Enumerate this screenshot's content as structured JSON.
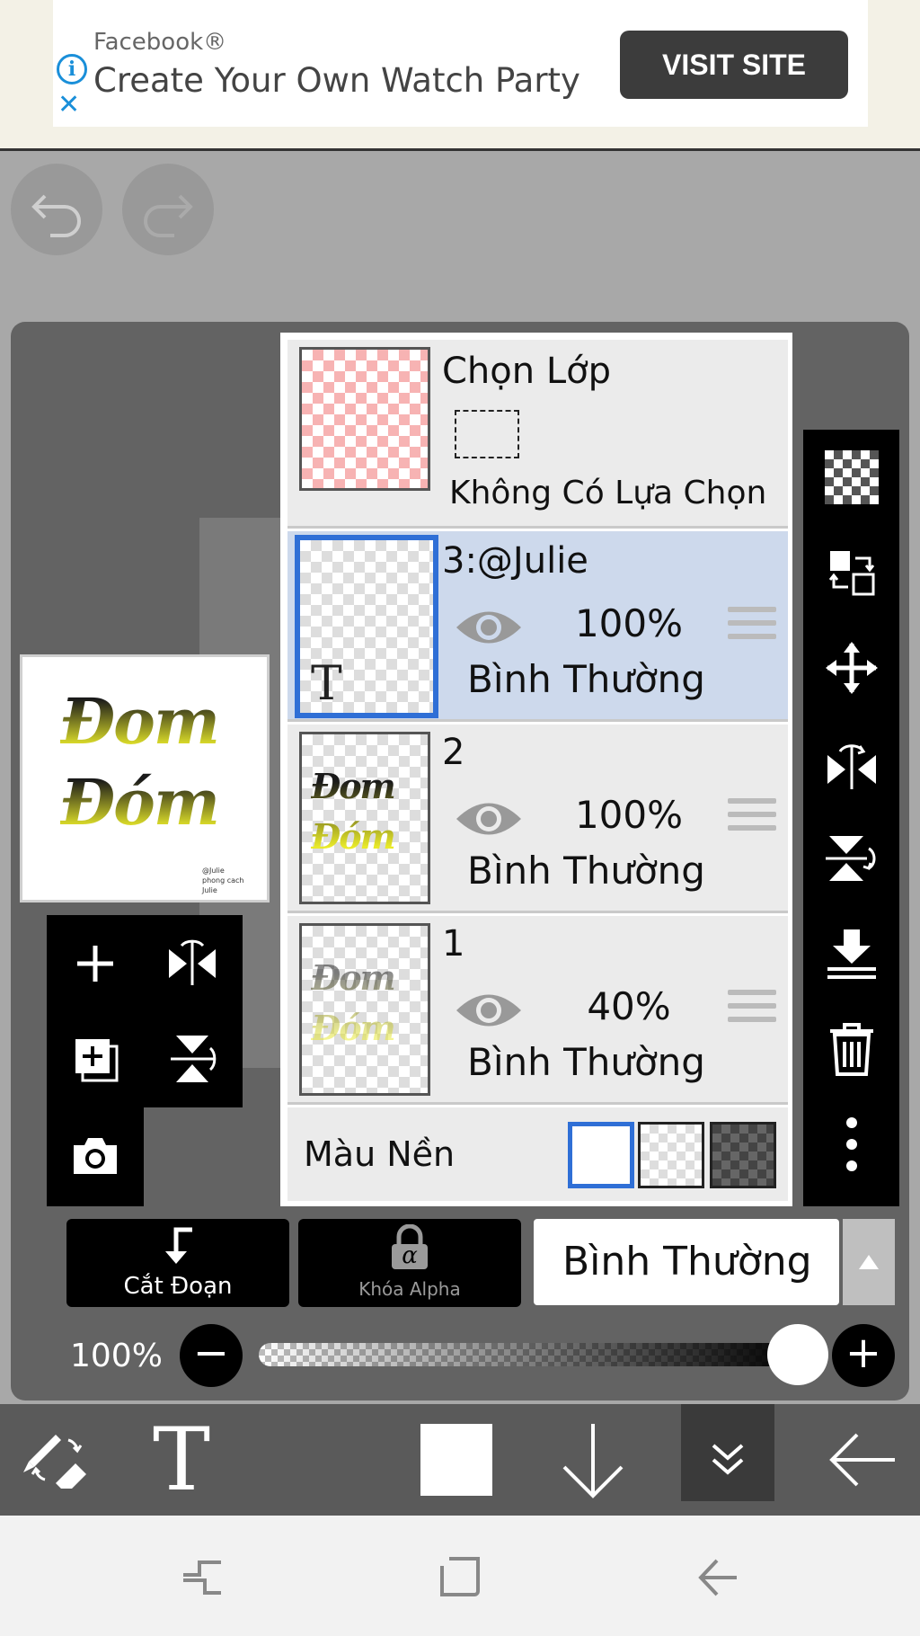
{
  "ad": {
    "brand": "Facebook®",
    "title": "Create Your Own Watch Party",
    "cta": "VISIT SITE"
  },
  "canvas_preview": {
    "line1": "Đom",
    "line2": "Đóm",
    "small_text": [
      "@Julie",
      "phong cach",
      "Julie"
    ]
  },
  "layers_panel": {
    "selection": {
      "title": "Chọn Lớp",
      "status": "Không Có Lựa Chọn"
    },
    "layers": [
      {
        "name": "3:@Julie",
        "opacity": "100%",
        "blend": "Bình Thường",
        "selected": true,
        "thumb_glyph": "T"
      },
      {
        "name": "2",
        "opacity": "100%",
        "blend": "Bình Thường",
        "selected": false,
        "thumb_glyph": "Đom Đóm"
      },
      {
        "name": "1",
        "opacity": "40%",
        "blend": "Bình Thường",
        "selected": false,
        "thumb_glyph": "Đom Đóm"
      }
    ],
    "background": {
      "label": "Màu Nền",
      "options": [
        "white",
        "transparent",
        "dark-checker"
      ],
      "selected": "white"
    }
  },
  "bottom_controls": {
    "clip_label": "Cắt Đoạn",
    "alpha_lock_label": "Khóa Alpha",
    "alpha_glyph": "α",
    "blend_mode": "Bình Thường",
    "opacity_label": "100%",
    "opacity_value": 1.0,
    "minus": "−",
    "plus": "+"
  },
  "main_toolbar": {
    "text_tool": "T",
    "color_swatch": "#ffffff"
  },
  "colors": {
    "accent_blue": "#2f6fd6",
    "selected_row": "#cdd9ec",
    "selection_thumb": "#f7b3b3"
  }
}
